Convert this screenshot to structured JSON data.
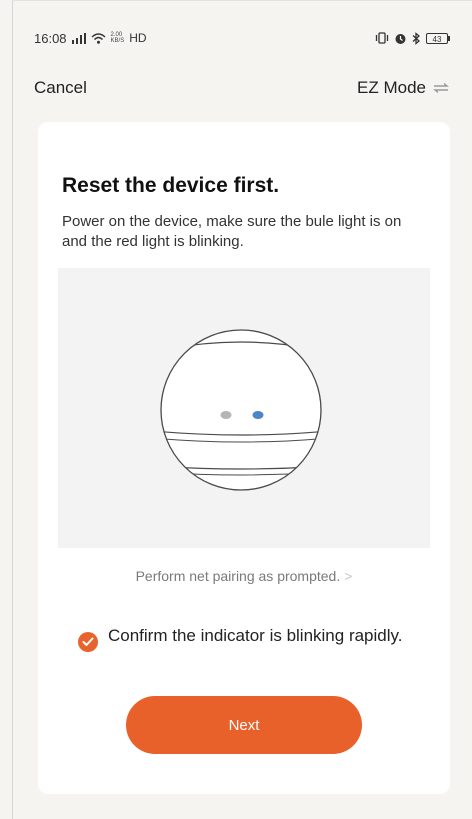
{
  "status_bar": {
    "time": "16:08",
    "speed_top": "2.00",
    "speed_bottom": "KB/S",
    "network": "HD",
    "battery": "43"
  },
  "nav": {
    "cancel_label": "Cancel",
    "mode_label": "EZ Mode"
  },
  "card": {
    "title": "Reset the device first.",
    "description": "Power on the device, make sure the bule light is on and the red light is blinking.",
    "pairing_link": "Perform net pairing as prompted.",
    "pairing_chevron": ">",
    "confirm_label": "Confirm the indicator is blinking rapidly.",
    "confirm_checked": true,
    "next_label": "Next"
  },
  "colors": {
    "accent": "#e8612a",
    "indicator_blue": "#4a86c8",
    "indicator_gray": "#b5b5b5"
  },
  "icons": {
    "signal": "signal-icon",
    "wifi": "wifi-icon",
    "vibrate": "vibrate-icon",
    "alarm": "alarm-icon",
    "bluetooth": "bluetooth-icon",
    "battery": "battery-icon",
    "mode_switch": "switch-arrows-icon",
    "check": "check-icon"
  }
}
